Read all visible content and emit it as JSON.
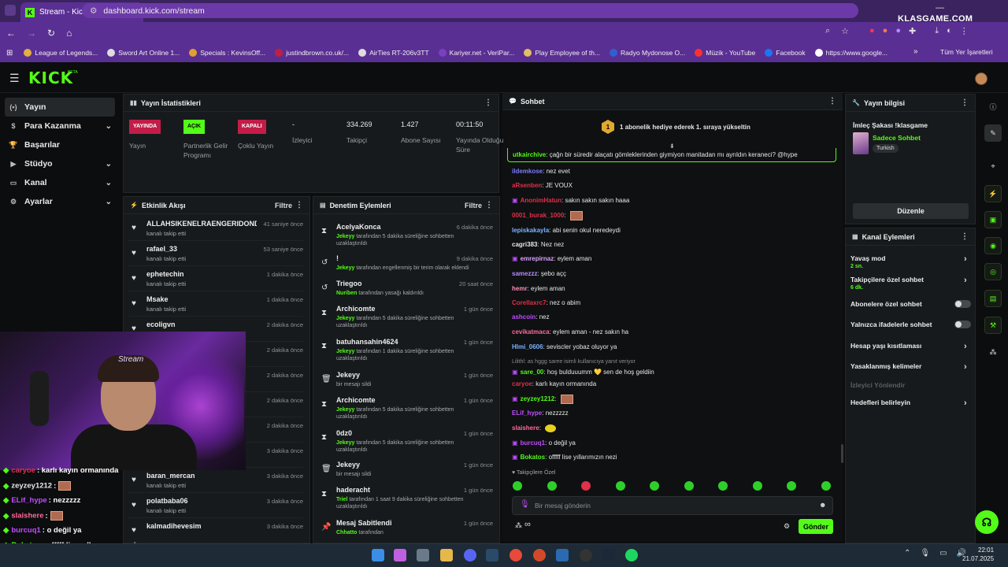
{
  "browser": {
    "tab_title": "Stream - Kick Dashboard",
    "url": "dashboard.kick.com/stream",
    "watermark": "KLASGAME.COM",
    "bookmarks": [
      "League of Legends...",
      "Sword Art Online 1...",
      "Specials : KevinsOff...",
      "justindbrown.co.uk/...",
      "AirTies RT-206v3TT",
      "Kariyer.net - VeriPar...",
      "Play Employee of th...",
      "Radyo Mydonose O...",
      "Müzik - YouTube",
      "Facebook",
      "https://www.google..."
    ],
    "bookmarks_right": "Tüm Yer İşaretleri"
  },
  "header": {
    "logo": "KICK",
    "beta": "BETA"
  },
  "sidebar": {
    "items": [
      {
        "label": "Yayın",
        "active": true
      },
      {
        "label": "Para Kazanma",
        "chevron": true
      },
      {
        "label": "Başarılar"
      },
      {
        "label": "Stüdyo",
        "chevron": true
      },
      {
        "label": "Kanal",
        "chevron": true
      },
      {
        "label": "Ayarlar",
        "chevron": true
      }
    ]
  },
  "stats": {
    "title": "Yayın İstatistikleri",
    "items": [
      {
        "badge": "YAYINDA",
        "label": "Yayın"
      },
      {
        "badge": "AÇIK",
        "label": "Partnerlik Gelir Programı"
      },
      {
        "badge": "KAPALI",
        "label": "Çoklu Yayın"
      },
      {
        "value": "-",
        "label": "İzleyici"
      },
      {
        "value": "334.269",
        "label": "Takipçi"
      },
      {
        "value": "1.427",
        "label": "Abone Sayısı"
      },
      {
        "value": "00:11:50",
        "label": "Yayında Olduğu Süre"
      }
    ]
  },
  "activity": {
    "title": "Etkinlik Akışı",
    "filter": "Filtre",
    "items": [
      {
        "name": "ALLAHSIKENELRAENGERIDONDU",
        "sub": "kanalı takip etti",
        "time": "41 saniye önce"
      },
      {
        "name": "rafael_33",
        "sub": "kanalı takip etti",
        "time": "53 saniye önce"
      },
      {
        "name": "ephetechin",
        "sub": "kanalı takip etti",
        "time": "1 dakika önce"
      },
      {
        "name": "Msake",
        "sub": "kanalı takip etti",
        "time": "1 dakika önce"
      },
      {
        "name": "ecoligvn",
        "sub": "",
        "time": "2 dakika önce"
      },
      {
        "name": "",
        "sub": "",
        "time": "2 dakika önce"
      },
      {
        "name": "",
        "sub": "",
        "time": "2 dakika önce"
      },
      {
        "name": "",
        "sub": "",
        "time": "2 dakika önce"
      },
      {
        "name": "",
        "sub": "",
        "time": "2 dakika önce"
      },
      {
        "name": "",
        "sub": "",
        "time": "3 dakika önce"
      },
      {
        "name": "baran_mercan",
        "sub": "kanalı takip etti",
        "time": "3 dakika önce"
      },
      {
        "name": "polatbaba06",
        "sub": "kanalı takip etti",
        "time": "3 dakika önce"
      },
      {
        "name": "kalmadihevesim",
        "sub": "",
        "time": "3 dakika önce"
      }
    ]
  },
  "moderation": {
    "title": "Denetim Eylemleri",
    "filter": "Filtre",
    "items": [
      {
        "name": "AcelyaKonca",
        "actor": "Jekeyy",
        "sub": "tarafından 5 dakika süreliğine sohbetten uzaklaştırıldı",
        "time": "6 dakika önce",
        "icon": "⧗"
      },
      {
        "name": "!",
        "actor": "Jekeyy",
        "sub": "tarafından engellenmiş bir terim olarak eklendi",
        "time": "9 dakika önce",
        "icon": "↺"
      },
      {
        "name": "Triegoo",
        "actor": "Nuriben",
        "sub": "tarafından yasağı kaldırıldı",
        "time": "20 saat önce",
        "icon": "↺"
      },
      {
        "name": "Archicomte",
        "actor": "Jekeyy",
        "sub": "tarafından 5 dakika süreliğine sohbetten uzaklaştırıldı",
        "time": "1 gün önce",
        "icon": "⧗"
      },
      {
        "name": "batuhansahin4624",
        "actor": "Jekeyy",
        "sub": "tarafından 1 dakika süreliğine sohbetten uzaklaştırıldı",
        "time": "1 gün önce",
        "icon": "⧗"
      },
      {
        "name": "Jekeyy",
        "actor": "",
        "sub": "bir mesajı sildi",
        "time": "1 gün önce",
        "icon": "🗑"
      },
      {
        "name": "Archicomte",
        "actor": "Jekeyy",
        "sub": "tarafından 5 dakika süreliğine sohbetten uzaklaştırıldı",
        "time": "1 gün önce",
        "icon": "⧗"
      },
      {
        "name": "0dz0",
        "actor": "Jekeyy",
        "sub": "tarafından 5 dakika süreliğine sohbetten uzaklaştırıldı",
        "time": "1 gün önce",
        "icon": "⧗"
      },
      {
        "name": "Jekeyy",
        "actor": "",
        "sub": "bir mesajı sildi",
        "time": "1 gün önce",
        "icon": "🗑"
      },
      {
        "name": "haderacht",
        "actor": "Triel",
        "sub": "tarafından 1 saat 9 dakika süreliğine sohbetten uzaklaştırıldı",
        "time": "1 gün önce",
        "icon": "⧗"
      },
      {
        "name": "Mesaj Sabitlendi",
        "actor": "Chhatto",
        "sub": "tarafından",
        "time": "1 gün önce",
        "icon": "📌"
      }
    ]
  },
  "chat": {
    "title": "Sohbet",
    "banner": "1 abonelik hediye ederek 1. sıraya yükseltin",
    "banner_num": "1",
    "pinned": {
      "user": "utkairchive",
      "text": "çağn bir süredir alaçatı gömleklerinden giymiyon manitadan mı ayrıldın keraneci? @hype"
    },
    "messages": [
      {
        "user": "ildemkose",
        "color": "#7d7cff",
        "text": "nez evet"
      },
      {
        "user": "aRsenben",
        "color": "#e0304a",
        "text": "JE VOUX"
      },
      {
        "user": "AnonimHatun",
        "color": "#e0304a",
        "text": "sakın sakın sakın haaa"
      },
      {
        "user": "0001_burak_1000",
        "color": "#e0304a",
        "text": ""
      },
      {
        "user": "lepiskakayla",
        "color": "#7bb2ff",
        "text": "abi senin okul neredeydi"
      },
      {
        "user": "cagri383",
        "color": "#e8e8e8",
        "text": "Nez nez"
      },
      {
        "user": "emrepirnaz",
        "color": "#d8a0ff",
        "text": "eylem aman"
      },
      {
        "user": "samezzz",
        "color": "#b48cff",
        "text": "şebo açç"
      },
      {
        "user": "hemr",
        "color": "#ff8fb6",
        "text": "eylem aman"
      },
      {
        "user": "Corellaxrc7",
        "color": "#e0304a",
        "text": "nez o abim"
      },
      {
        "user": "ashcoin",
        "color": "#c04cff",
        "text": "nez"
      },
      {
        "user": "cevikatmaca",
        "color": "#ff6a9a",
        "text": "eylem aman - nez sakın ha"
      },
      {
        "user": "Hlmi_0606",
        "color": "#7bb2ff",
        "text": "seviscler yobaz oluyor ya"
      },
      {
        "user": "sare_00",
        "color": "#53fc18",
        "text": "hoş bulduuumm 💛  sen de hoş geldiin",
        "reply": "Lilithl: as hggg saree isimli kullanıcıya yanıt veriyor"
      },
      {
        "user": "caryoe",
        "color": "#e0304a",
        "text": "karlı kayın ormanında"
      },
      {
        "user": "zeyzey1212",
        "color": "#53fc18",
        "text": ""
      },
      {
        "user": "ELif_hype",
        "color": "#c04cff",
        "text": "nezzzzz"
      },
      {
        "user": "slaishere",
        "color": "#ff6a9a",
        "text": ""
      },
      {
        "user": "burcuq1",
        "color": "#c04cff",
        "text": "o değil ya"
      },
      {
        "user": "Bokatos",
        "color": "#53fc18",
        "text": "offfff lise yıllarımızın nezi"
      }
    ],
    "followers_only": "Takipçilere Özel",
    "input_placeholder": "Bir mesaj gönderin",
    "send": "Gönder",
    "points": "∞"
  },
  "info": {
    "title": "Yayın bilgisi",
    "stream_title": "İmleç Şakası !klasgame",
    "category": "Sadece Sohbet",
    "language": "Turkish",
    "edit": "Düzenle"
  },
  "channel_actions": {
    "title": "Kanal Eylemleri",
    "rows": [
      {
        "label": "Yavaş mod",
        "sub": "2 sn.",
        "type": "arrow"
      },
      {
        "label": "Takipçilere özel sohbet",
        "sub": "6 dk.",
        "type": "arrow"
      },
      {
        "label": "Abonelere özel sohbet",
        "type": "toggle"
      },
      {
        "label": "Yalnızca ifadelerle sohbet",
        "type": "toggle"
      },
      {
        "label": "Hesap yaşı kısıtlaması",
        "type": "arrow"
      },
      {
        "label": "Yasaklanmış kelimeler",
        "type": "arrow"
      },
      {
        "label": "İzleyici Yönlendir",
        "type": "disabled"
      },
      {
        "label": "Hedefleri belirleyin",
        "type": "arrow"
      }
    ]
  },
  "overlay_chat": [
    {
      "user": "caryoe",
      "color": "#e0304a",
      "text": ": karlı kayın ormanında"
    },
    {
      "user": "zeyzey1212",
      "color": "#e8e8e8",
      "text": ":"
    },
    {
      "user": "ELif_hype",
      "color": "#c04cff",
      "text": ": nezzzzz"
    },
    {
      "user": "slaishere",
      "color": "#ff6a9a",
      "text": ":"
    },
    {
      "user": "burcuq1",
      "color": "#c04cff",
      "text": ": o değil ya"
    },
    {
      "user": "Bokatos",
      "color": "#53fc18",
      "text": ": offfff lise yıllarımızın nezi"
    }
  ],
  "cam": {
    "sign": "Stream"
  },
  "taskbar": {
    "time": "22:01",
    "date": "21.07.2025"
  }
}
